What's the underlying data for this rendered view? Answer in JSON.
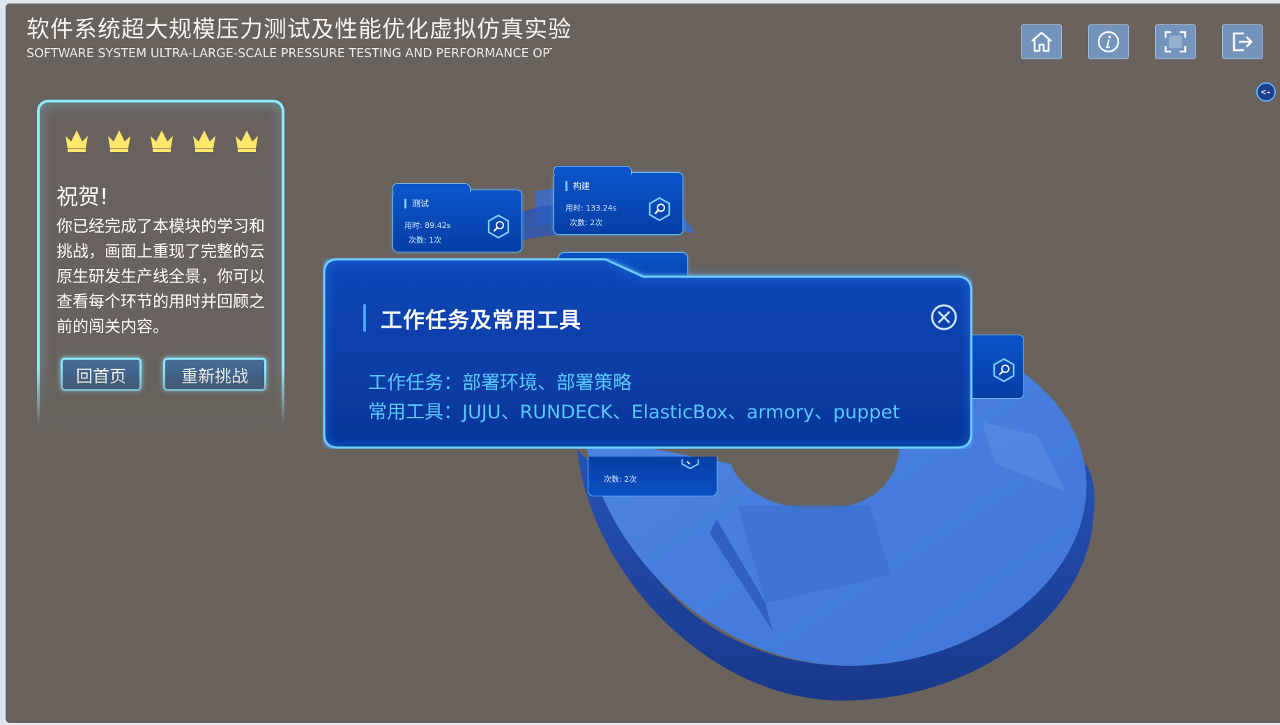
{
  "header": {
    "title": "软件系统超大规模压力测试及性能优化虚拟仿真实验",
    "subtitle": "SOFTWARE SYSTEM ULTRA-LARGE-SCALE PRESSURE TESTING AND PERFORMANCE OPTI"
  },
  "toolbar": {
    "buttons": [
      {
        "name": "home",
        "icon": "home-icon"
      },
      {
        "name": "info",
        "icon": "info-icon"
      },
      {
        "name": "fullscreen",
        "icon": "fullscreen-icon"
      },
      {
        "name": "exit",
        "icon": "exit-icon"
      }
    ],
    "collapse_label": "<-"
  },
  "congrats": {
    "rating": {
      "stars": 5,
      "max": 5,
      "icon": "crown-icon"
    },
    "title": "祝贺!",
    "body": "你已经完成了本模块的学习和挑战，画面上重现了完整的云原生研发生产线全景，你可以查看每个环节的用时并回顾之前的闯关内容。",
    "home_button": "回首页",
    "retry_button": "重新挑战"
  },
  "stages": [
    {
      "name": "测试",
      "time": "用时: 89.42s",
      "count": "次数: 1次"
    },
    {
      "name": "构建",
      "time": "用时: 133.24s",
      "count": "次数: 2次"
    }
  ],
  "lower_stage": {
    "count": "次数: 2次"
  },
  "modal": {
    "title": "工作任务及常用工具",
    "tasks": "工作任务：部署环境、部署策略",
    "tools": "常用工具：JUJU、RUNDECK、ElasticBox、armory、puppet"
  },
  "colors": {
    "scene_bg": "#69625d",
    "panel_glow": "#8feaff",
    "card_blue": "#0b54c9",
    "modal_text": "#58c8ff",
    "crown": "#ffe86a"
  }
}
